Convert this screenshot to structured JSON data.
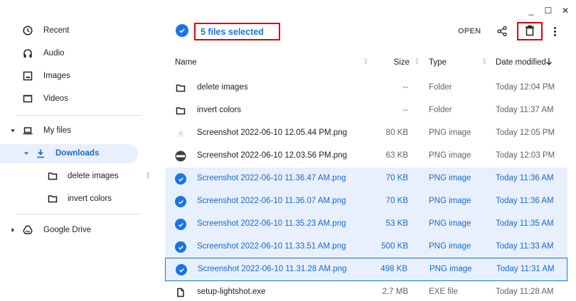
{
  "window": {
    "minimize": "_",
    "maximize": "☐",
    "close": "✕"
  },
  "sidebar": {
    "items": [
      {
        "label": "Recent"
      },
      {
        "label": "Audio"
      },
      {
        "label": "Images"
      },
      {
        "label": "Videos"
      },
      {
        "label": "My files"
      },
      {
        "label": "Downloads"
      },
      {
        "label": "delete images"
      },
      {
        "label": "invert colors"
      },
      {
        "label": "Google Drive"
      }
    ]
  },
  "toolbar": {
    "selection_label": "5 files selected",
    "open_label": "OPEN",
    "icons": [
      "share-icon",
      "delete-icon",
      "more-vert-icon"
    ]
  },
  "table": {
    "headers": {
      "name": "Name",
      "size": "Size",
      "type": "Type",
      "date": "Date modified"
    },
    "sort": {
      "column": "Date modified",
      "direction": "down-arrow"
    },
    "rows": [
      {
        "name": "delete images",
        "size": "--",
        "type": "Folder",
        "date": "Today 12:04 PM",
        "icon": "folder-icon",
        "selected": false
      },
      {
        "name": "invert colors",
        "size": "--",
        "type": "Folder",
        "date": "Today 11:37 AM",
        "icon": "folder-icon",
        "selected": false
      },
      {
        "name": "Screenshot 2022-06-10 12.05.44 PM.png",
        "size": "80 KB",
        "type": "PNG image",
        "date": "Today 12:05 PM",
        "icon": "image-thumbnail-icon",
        "selected": false
      },
      {
        "name": "Screenshot 2022-06-10 12.03.56 PM.png",
        "size": "63 KB",
        "type": "PNG image",
        "date": "Today 12:03 PM",
        "icon": "image-thumbnail-icon",
        "selected": false
      },
      {
        "name": "Screenshot 2022-06-10 11.36.47 AM.png",
        "size": "70 KB",
        "type": "PNG image",
        "date": "Today 11:36 AM",
        "icon": "check-icon",
        "selected": true
      },
      {
        "name": "Screenshot 2022-06-10 11.36.07 AM.png",
        "size": "70 KB",
        "type": "PNG image",
        "date": "Today 11:36 AM",
        "icon": "check-icon",
        "selected": true
      },
      {
        "name": "Screenshot 2022-06-10 11.35.23 AM.png",
        "size": "53 KB",
        "type": "PNG image",
        "date": "Today 11:35 AM",
        "icon": "check-icon",
        "selected": true
      },
      {
        "name": "Screenshot 2022-06-10 11.33.51 AM.png",
        "size": "500 KB",
        "type": "PNG image",
        "date": "Today 11:33 AM",
        "icon": "check-icon",
        "selected": true
      },
      {
        "name": "Screenshot 2022-06-10 11.31.28 AM.png",
        "size": "498 KB",
        "type": "PNG image",
        "date": "Today 11:31 AM",
        "icon": "check-icon",
        "selected": true
      },
      {
        "name": "setup-lightshot.exe",
        "size": "2.7 MB",
        "type": "EXE file",
        "date": "Today 11:28 AM",
        "icon": "file-icon",
        "selected": false
      }
    ]
  },
  "colors": {
    "accent": "#1a73e8",
    "selection_bg": "#e8f0fe",
    "highlight_border": "#e00000"
  }
}
